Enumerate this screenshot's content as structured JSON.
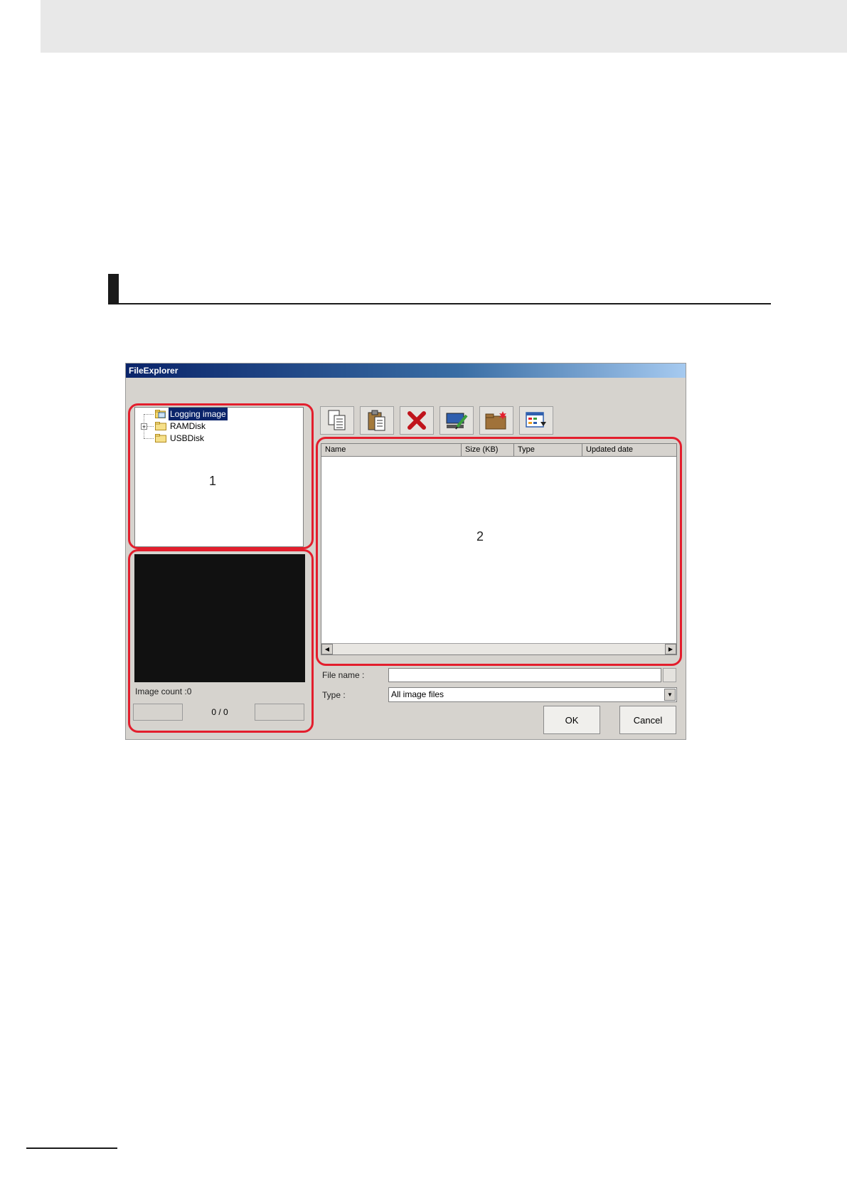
{
  "window": {
    "title": "FileExplorer"
  },
  "tree": {
    "items": [
      {
        "label": "Logging image",
        "icon": "image-folder-icon",
        "selected": true
      },
      {
        "label": "RAMDisk",
        "icon": "folder-icon",
        "expander": "+"
      },
      {
        "label": "USBDisk",
        "icon": "folder-icon"
      }
    ]
  },
  "preview": {
    "image_count_label": "Image count :0",
    "page_text": "0 / 0"
  },
  "toolbar": {
    "buttons": [
      {
        "name": "copy-icon"
      },
      {
        "name": "paste-icon"
      },
      {
        "name": "delete-icon"
      },
      {
        "name": "rename-icon"
      },
      {
        "name": "new-folder-icon"
      },
      {
        "name": "view-options-icon"
      }
    ]
  },
  "list": {
    "columns": [
      "Name",
      "Size (KB)",
      "Type",
      "Updated date"
    ]
  },
  "fields": {
    "file_name_label": "File name :",
    "file_name_value": "",
    "type_label": "Type :",
    "type_value": "All image files"
  },
  "buttons": {
    "ok": "OK",
    "cancel": "Cancel"
  },
  "callouts": {
    "one": "1",
    "two": "2"
  },
  "colors": {
    "callout": "#e31e2d",
    "titlebar": "#0a246a",
    "window_bg": "#d6d3ce"
  }
}
